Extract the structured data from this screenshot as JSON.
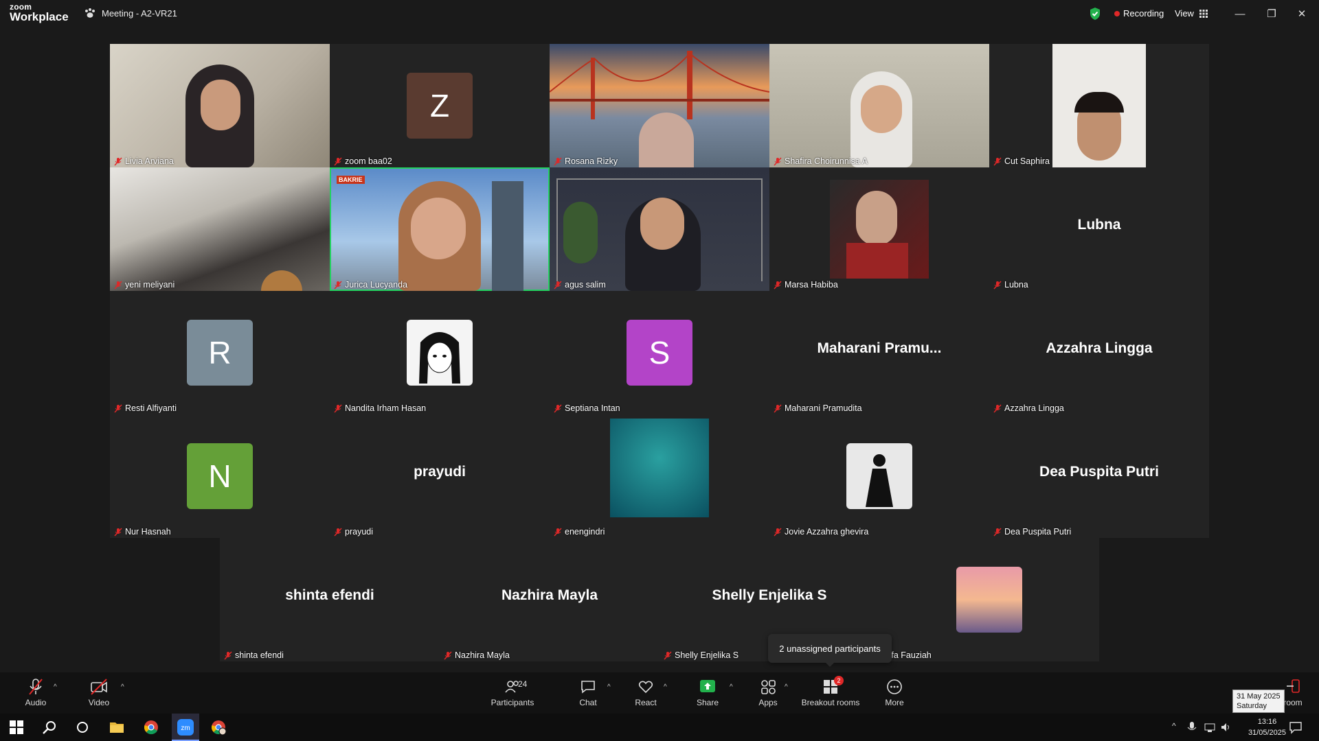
{
  "app": {
    "logo_line1": "zoom",
    "logo_line2": "Workplace",
    "meeting_title": "Meeting - A2-VR21",
    "recording_label": "Recording",
    "view_label": "View"
  },
  "colors": {
    "active_speaker": "#23d160",
    "recording": "#e02828",
    "shield": "#23b14d"
  },
  "participants_row1": [
    {
      "name": "Livia Arviana"
    },
    {
      "name": "zoom baa02",
      "initial": "Z"
    },
    {
      "name": "Rosana Rizky"
    },
    {
      "name": "Shafira Choirunnisa A"
    },
    {
      "name": "Cut Saphira"
    }
  ],
  "participants_row2": [
    {
      "name": "yeni meliyani"
    },
    {
      "name": "Jurica Lucyanda",
      "logo_text": "BAKRIE"
    },
    {
      "name": "agus salim"
    },
    {
      "name": "Marsa Habiba"
    },
    {
      "name": "Lubna",
      "display": "Lubna"
    }
  ],
  "participants_row3": [
    {
      "name": "Resti Alfiyanti",
      "initial": "R"
    },
    {
      "name": "Nandita Irham Hasan"
    },
    {
      "name": "Septiana Intan",
      "initial": "S"
    },
    {
      "name": "Maharani Pramudita",
      "display": "Maharani  Pramu..."
    },
    {
      "name": "Azzahra Lingga",
      "display": "Azzahra Lingga"
    }
  ],
  "participants_row4": [
    {
      "name": "Nur Hasnah",
      "initial": "N"
    },
    {
      "name": "prayudi",
      "display": "prayudi"
    },
    {
      "name": "enengindri"
    },
    {
      "name": "Jovie Azzahra ghevira"
    },
    {
      "name": "Dea Puspita Putri",
      "display": "Dea Puspita Putri"
    }
  ],
  "participants_row5": [
    {
      "name": "shinta efendi",
      "display": "shinta efendi"
    },
    {
      "name": "Nazhira Mayla",
      "display": "Nazhira Mayla"
    },
    {
      "name": "Shelly Enjelika S",
      "display": "Shelly Enjelika S"
    },
    {
      "name": "Syifa Fauziah"
    }
  ],
  "tooltip": "2 unassigned participants",
  "toolbar": {
    "audio": "Audio",
    "video": "Video",
    "participants": "Participants",
    "participants_count": "24",
    "chat": "Chat",
    "react": "React",
    "share": "Share",
    "apps": "Apps",
    "breakout": "Breakout rooms",
    "breakout_badge": "2",
    "more": "More",
    "room_partial": "room"
  },
  "taskbar": {
    "time": "13:16",
    "date": "31/05/2025",
    "tip_date": "31 May 2025",
    "tip_day": "Saturday"
  }
}
